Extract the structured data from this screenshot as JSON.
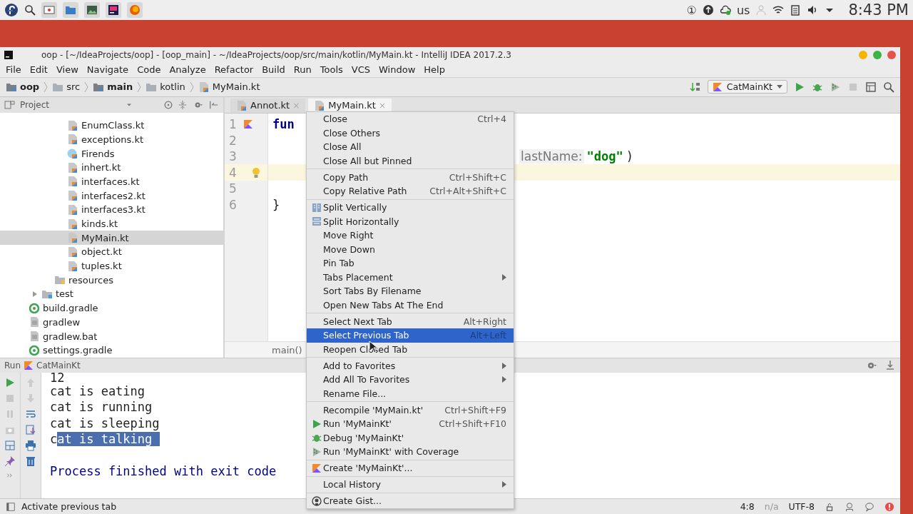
{
  "taskbar": {
    "tray_count": "①",
    "keyboard": "us",
    "clock": "8:43 PM"
  },
  "window": {
    "title": "oop - [~/IdeaProjects/oop] - [oop_main] - ~/IdeaProjects/oop/src/main/kotlin/MyMain.kt - IntelliJ IDEA 2017.2.3"
  },
  "menu_bar": [
    "File",
    "Edit",
    "View",
    "Navigate",
    "Code",
    "Analyze",
    "Refactor",
    "Build",
    "Run",
    "Tools",
    "VCS",
    "Window",
    "Help"
  ],
  "breadcrumbs": [
    {
      "label": "oop",
      "kind": "module",
      "bold": true
    },
    {
      "label": "src",
      "kind": "folder",
      "bold": false
    },
    {
      "label": "main",
      "kind": "module",
      "bold": true
    },
    {
      "label": "kotlin",
      "kind": "folder",
      "bold": false
    },
    {
      "label": "MyMain.kt",
      "kind": "kt",
      "bold": false
    }
  ],
  "run_config": "CatMainKt",
  "project_panel": {
    "title": "Project",
    "tree": [
      {
        "children": [
          {
            "children": [
              {
                "children": [
                  {
                    "label": "EnumClass.kt",
                    "kind": "kt",
                    "selected": false
                  },
                  {
                    "label": "exceptions.kt",
                    "kind": "kt",
                    "selected": false
                  },
                  {
                    "label": "Firends",
                    "kind": "class",
                    "selected": false
                  },
                  {
                    "label": "inhert.kt",
                    "kind": "kt",
                    "selected": false
                  },
                  {
                    "label": "interfaces.kt",
                    "kind": "kt",
                    "selected": false
                  },
                  {
                    "label": "interfaces2.kt",
                    "kind": "kt",
                    "selected": false
                  },
                  {
                    "label": "interfaces3.kt",
                    "kind": "kt",
                    "selected": false
                  },
                  {
                    "label": "kinds.kt",
                    "kind": "kt",
                    "selected": false
                  },
                  {
                    "label": "MyMain.kt",
                    "kind": "kt",
                    "selected": true
                  },
                  {
                    "label": "object.kt",
                    "kind": "kt",
                    "selected": false
                  },
                  {
                    "label": "tuples.kt",
                    "kind": "kt",
                    "selected": false
                  }
                ]
              },
              {
                "label": "resources",
                "kind": "resources",
                "selected": false
              }
            ]
          },
          {
            "label": "test",
            "kind": "test-folder",
            "selected": false,
            "expanded": false
          }
        ]
      },
      {
        "label": "build.gradle",
        "kind": "gradle",
        "selected": false
      },
      {
        "label": "gradlew",
        "kind": "text",
        "selected": false
      },
      {
        "label": "gradlew.bat",
        "kind": "text",
        "selected": false
      },
      {
        "label": "settings.gradle",
        "kind": "gradle",
        "selected": false
      }
    ]
  },
  "editor": {
    "tabs": [
      {
        "label": "Annot.kt",
        "close": "×",
        "selected": false
      },
      {
        "label": "MyMain.kt",
        "close": "×",
        "selected": true
      }
    ],
    "lines": [
      {
        "number": "1",
        "kind": "kotlin",
        "current": false,
        "left": [
          {
            "text": "fun",
            "kind": "keyword"
          }
        ]
      },
      {
        "number": "2",
        "kind": "plain",
        "current": false
      },
      {
        "number": "3",
        "kind": "plain",
        "current": false,
        "right": [
          {
            "text": "lastName:",
            "kind": "hint"
          },
          {
            "text": "\"dog\"",
            "kind": "string"
          },
          {
            "text": ")",
            "kind": "plain"
          }
        ]
      },
      {
        "number": "4",
        "kind": "bulb",
        "current": true
      },
      {
        "number": "5",
        "kind": "plain",
        "current": false
      },
      {
        "number": "6",
        "kind": "plain",
        "current": false,
        "left": [
          {
            "text": "}",
            "kind": "plain"
          }
        ]
      }
    ],
    "breadcrumb": "main()"
  },
  "run_panel": {
    "title": "Run",
    "config": "CatMainKt",
    "output": [
      {
        "kind": "stdout",
        "segments": [
          {
            "text": "12",
            "selected": false
          }
        ]
      },
      {
        "kind": "stdout",
        "segments": [
          {
            "text": "cat is eating",
            "selected": false
          }
        ]
      },
      {
        "kind": "stdout",
        "segments": [
          {
            "text": "cat is running",
            "selected": false
          }
        ]
      },
      {
        "kind": "stdout",
        "segments": [
          {
            "text": "cat is sleeping",
            "selected": false
          }
        ]
      },
      {
        "kind": "stdout",
        "segments": [
          {
            "text": "c",
            "selected": false
          },
          {
            "text": "at is talking ",
            "selected": true
          }
        ]
      },
      {
        "kind": "blank"
      },
      {
        "kind": "system",
        "segments": [
          {
            "text": "Process finished with exit code",
            "selected": false
          }
        ]
      }
    ]
  },
  "status_bar": {
    "message": "Activate previous tab",
    "position": "4:8",
    "line_separator": "n/a",
    "encoding": "UTF-8"
  },
  "context_menu": [
    {
      "kind": "item",
      "label": "Close",
      "shortcut": "Ctrl+4",
      "selected": false
    },
    {
      "kind": "item",
      "label": "Close Others",
      "selected": false
    },
    {
      "kind": "item",
      "label": "Close All",
      "selected": false
    },
    {
      "kind": "item",
      "label": "Close All but Pinned",
      "selected": false
    },
    {
      "kind": "separator"
    },
    {
      "kind": "item",
      "label": "Copy Path",
      "shortcut": "Ctrl+Shift+C",
      "selected": false
    },
    {
      "kind": "item",
      "label": "Copy Relative Path",
      "shortcut": "Ctrl+Alt+Shift+C",
      "selected": false
    },
    {
      "kind": "separator"
    },
    {
      "kind": "split-v",
      "label": "Split Vertically",
      "selected": false
    },
    {
      "kind": "split-h",
      "label": "Split Horizontally",
      "selected": false
    },
    {
      "kind": "item",
      "label": "Move Right",
      "selected": false
    },
    {
      "kind": "item",
      "label": "Move Down",
      "selected": false
    },
    {
      "kind": "item",
      "label": "Pin Tab",
      "selected": false
    },
    {
      "kind": "submenu",
      "label": "Tabs Placement",
      "selected": false
    },
    {
      "kind": "item",
      "label": "Sort Tabs By Filename",
      "selected": false
    },
    {
      "kind": "item",
      "label": "Open New Tabs At The End",
      "selected": false
    },
    {
      "kind": "separator"
    },
    {
      "kind": "item",
      "label": "Select Next Tab",
      "shortcut": "Alt+Right",
      "selected": false
    },
    {
      "kind": "item",
      "label": "Select Previous Tab",
      "shortcut": "Alt+Left",
      "selected": true
    },
    {
      "kind": "item",
      "label": "Reopen Closed Tab",
      "selected": false
    },
    {
      "kind": "separator"
    },
    {
      "kind": "submenu",
      "label": "Add to Favorites",
      "selected": false
    },
    {
      "kind": "submenu",
      "label": "Add All To Favorites",
      "selected": false
    },
    {
      "kind": "item",
      "label": "Rename File...",
      "selected": false
    },
    {
      "kind": "separator"
    },
    {
      "kind": "item",
      "label": "Recompile 'MyMain.kt'",
      "shortcut": "Ctrl+Shift+F9",
      "selected": false
    },
    {
      "kind": "run",
      "label": "Run 'MyMainKt'",
      "shortcut": "Ctrl+Shift+F10",
      "selected": false
    },
    {
      "kind": "debug",
      "label": "Debug 'MyMainKt'",
      "selected": false
    },
    {
      "kind": "coverage",
      "label": "Run 'MyMainKt' with Coverage",
      "selected": false
    },
    {
      "kind": "separator"
    },
    {
      "kind": "kotlin",
      "label": "Create 'MyMainKt'...",
      "selected": false
    },
    {
      "kind": "separator"
    },
    {
      "kind": "submenu",
      "label": "Local History",
      "selected": false
    },
    {
      "kind": "separator"
    },
    {
      "kind": "github",
      "label": "Create Gist...",
      "selected": false
    }
  ]
}
